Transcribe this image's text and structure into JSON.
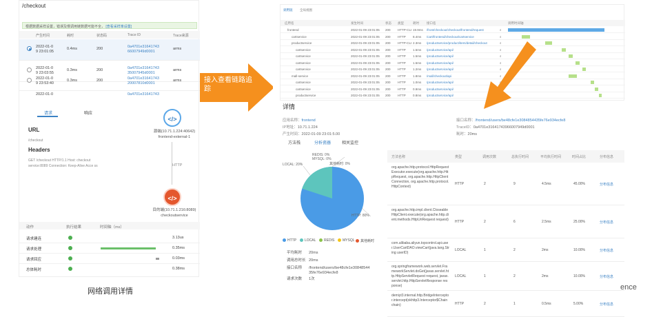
{
  "left_panel": {
    "title": "/checkout",
    "notice": {
      "text": "根据数据采样设置，错误及慢调用链数据可能不全，",
      "link": "[查看采样率设置]"
    },
    "columns": [
      "产生时间",
      "耗时",
      "状态码",
      "Trace ID",
      "Trace来源"
    ],
    "rows": [
      {
        "time1": "2022-01-0",
        "time2": "9 23:01:05",
        "dur": "0.4ms",
        "status": "200",
        "tid1": "0a4701e31641743",
        "tid2": "66007949d0001",
        "src": "arms",
        "selected": true
      },
      {
        "time1": "2022-01-0",
        "time2": "9 23:03:55",
        "dur": "0.3ms",
        "status": "200",
        "tid1": "0a4701e31641743",
        "tid2": "35007945d0001",
        "src": "arms",
        "selected": false
      },
      {
        "time1": "2022-01-0",
        "time2": "9 23:53:40",
        "dur": "0.3ms",
        "status": "200",
        "tid1": "0a4701e31641743",
        "tid2": "20007810d0001",
        "src": "arms",
        "selected": false
      },
      {
        "time1": "2022-01-0",
        "time2": "",
        "dur": "",
        "status": "",
        "tid1": "0a4701e31641743",
        "tid2": "",
        "src": "",
        "selected": false
      }
    ],
    "tabs": [
      "请求",
      "响应"
    ],
    "url_label": "URL",
    "url_value": "/checkout",
    "headers_label": "Headers",
    "headers_value": "GET /checkout HTTP/1.1 Host: checkout service:8089 Connection: Keep-Alive Acce ss",
    "source_node": {
      "line1": "源端(10.71.1.224:40642)",
      "line2": "frontend-external-1"
    },
    "edge_label": "HTTP",
    "target_node": {
      "line1": "目的端(10.71.1.216:8089)",
      "line2": "checkoutservice"
    },
    "timing_columns": [
      "动作",
      "执行结果",
      "时间轴（ms）"
    ],
    "timing_rows": [
      {
        "label": "请求建连",
        "value": "3.13us"
      },
      {
        "label": "请求处理",
        "value": "0.35ms"
      },
      {
        "label": "请求回应",
        "value": "0.03ms"
      },
      {
        "label": "总体耗时",
        "value": "0.38ms"
      }
    ],
    "caption": "网络调用详情"
  },
  "arrow_label": "接入查看链路追踪",
  "right_panel": {
    "top_tabs": [
      "调用链",
      "全局视图"
    ],
    "columns": [
      "应用名",
      "发生时间",
      "状态",
      "类型",
      "耗时",
      "接口名",
      "调用时间轴"
    ],
    "rows": [
      {
        "app": "frontend",
        "time": "2022-01-09 23:01:05",
        "status": "200",
        "type": "HTTP-CLI",
        "dur": "19.9ms",
        "iface": "/front/checkout/checkout/frontend/request"
      },
      {
        "app": "cartservice",
        "time": "2022-01-09 23:01:05",
        "status": "200",
        "type": "HTTP",
        "dur": "8.4ms",
        "iface": "/cart/frontend/checkout/cartservice"
      },
      {
        "app": "productservice",
        "time": "2022-01-09 23:01:05",
        "status": "200",
        "type": "HTTP-CLI",
        "dur": "2.3ms",
        "iface": "/productservice/product/item/detail/checkout"
      },
      {
        "app": "cartservice",
        "time": "2022-01-09 23:01:05",
        "status": "200",
        "type": "HTTP",
        "dur": "1.5ms",
        "iface": "/productservice/api/"
      },
      {
        "app": "cartservice",
        "time": "2022-01-09 23:01:05",
        "status": "200",
        "type": "HTTP",
        "dur": "1.5ms",
        "iface": "/productservice/api/"
      },
      {
        "app": "cartservice",
        "time": "2022-01-09 23:01:05",
        "status": "200",
        "type": "HTTP",
        "dur": "1.5ms",
        "iface": "/productservice/api/"
      },
      {
        "app": "cartservice",
        "time": "2022-01-09 23:01:05",
        "status": "200",
        "type": "HTTP",
        "dur": "1.2ms",
        "iface": "/productservice/api/"
      },
      {
        "app": "mall-service",
        "time": "2022-01-09 23:01:05",
        "status": "200",
        "type": "HTTP",
        "dur": "1.8ms",
        "iface": "/mall/checkout/api"
      },
      {
        "app": "cartservice",
        "time": "2022-01-09 23:01:05",
        "status": "200",
        "type": "HTTP",
        "dur": "1.0ms",
        "iface": "/productservice/api/"
      },
      {
        "app": "cartservice",
        "time": "2022-01-09 23:01:05",
        "status": "200",
        "type": "HTTP",
        "dur": "0.9ms",
        "iface": "/productservice/api/"
      },
      {
        "app": "productservice",
        "time": "2022-01-09 23:01:05",
        "status": "200",
        "type": "HTTP",
        "dur": "0.8ms",
        "iface": "/productservice/api/"
      }
    ],
    "detail_title": "详情",
    "app_label": "应用名称：",
    "app_value": "frontend",
    "ip_label": "IP地址：",
    "ip_value": "10.71.1.224",
    "time_label": "产生时间：",
    "time_value": "2022-01-09 23:01:5.00",
    "iface_label": "接口名称：",
    "iface_value": "/frontend/users/be48cfe1e3084854435fe76e934ecfe8",
    "traceid_label": "TraceID：",
    "traceid_value": "0a4701e31641743966007949d0001",
    "dur_label": "耗时：",
    "dur_value": "20ms",
    "detail_tabs": [
      "方法栈",
      "分析瓷器",
      "相关监控"
    ],
    "pie_labels": [
      "REDIS: 0%",
      "MYSQL: 0%",
      "其他耗时: 0%",
      "LOCAL: 20%",
      "HTTP: 80%"
    ],
    "legend": [
      "HTTP",
      "LOCAL",
      "REDIS",
      "MYSQL",
      "其他耗时"
    ],
    "stats": [
      {
        "k": "平均耗时",
        "v": "20ms"
      },
      {
        "k": "调用总时长",
        "v": "20ms"
      },
      {
        "k": "接口名称",
        "v": "/frontend/users/be48cfe1e3084854435fe76e934ecfe8"
      },
      {
        "k": "请求次数",
        "v": "1次"
      }
    ],
    "method_columns": [
      "方法名称",
      "类型",
      "调用次数",
      "总执行时间",
      "平均执行时间",
      "时间占比",
      "分布信息"
    ],
    "method_rows": [
      {
        "name": "org.apache.http.protocol.HttpRequestExecutor.execute(org.apache.http.HttpRequest, org.apache.http.HttpClientConnection, org.apache.http.protocol.HttpContext)",
        "type": "HTTP",
        "calls": "2",
        "total": "9",
        "avg": "4.5ms",
        "pct": "45.00%",
        "dist": "分布信息"
      },
      {
        "name": "org.apache.http.impl.client.CloseableHttpClient.execute(org.apache.http.client.methods.HttpUriRequest request)",
        "type": "HTTP",
        "calls": "2",
        "total": "6",
        "avg": "2.5ms",
        "pct": "25.00%",
        "dist": "分布信息"
      },
      {
        "name": "com.alibaba.aliyun.topcontrol.api.user.UserCartDAO.viewCart(java.lang.String userID)",
        "type": "LOCAL",
        "calls": "1",
        "total": "2",
        "avg": "2ms",
        "pct": "10.00%",
        "dist": "分布信息"
      },
      {
        "name": "org.springframework.web.servlet.FrameworkServlet.doGet(javax.servlet.http.HttpServletRequest request, javax.servlet.http.HttpServletResponse response)",
        "type": "LOCAL",
        "calls": "1",
        "total": "2",
        "avg": "2ms",
        "pct": "10.00%",
        "dist": "分布信息"
      },
      {
        "name": "demiyt3.internal.http.BridgeInterceptor.intercept(okhttp3.Interceptor$Chain chain)",
        "type": "HTTP",
        "calls": "2",
        "total": "1",
        "avg": "0.5ms",
        "pct": "5.00%",
        "dist": "分布信息"
      }
    ],
    "brand": "ence"
  },
  "colors": {
    "accent": "#3b82c4",
    "arrow": "#f5901e",
    "pie_http": "#4a9be6",
    "pie_local": "#5dc5bd",
    "ok": "#4caf50"
  }
}
